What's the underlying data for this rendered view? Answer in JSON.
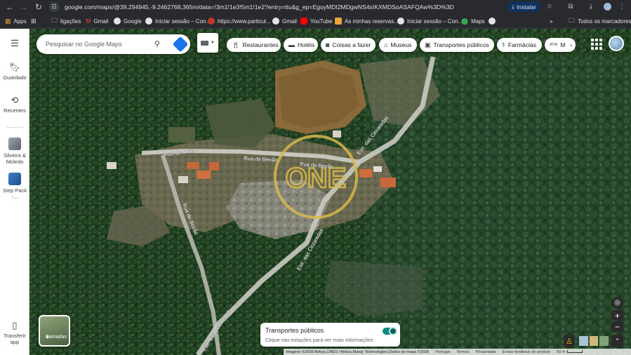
{
  "browser": {
    "url": "google.com/maps/@39.294945,-9.2462768,365m/data=!3m1!1e3!5m1!1e2?entry=ttu&g_ep=EgoyMDI2MDgwNS4xIKXMDSoASAFQAw%3D%3D",
    "install_label": "Instalar",
    "bookmarks": [
      {
        "label": "Apps",
        "icon": "apps-grid-icon"
      },
      {
        "label": "ligações",
        "icon": "folder-icon"
      },
      {
        "label": "Gmail",
        "icon": "gmail-icon"
      },
      {
        "label": "Google",
        "icon": "google-icon"
      },
      {
        "label": "Iniciar sessão – Con...",
        "icon": "google-icon"
      },
      {
        "label": "https://www.particul...",
        "icon": "site-icon"
      },
      {
        "label": "Gmail",
        "icon": "google-icon"
      },
      {
        "label": "YouTube",
        "icon": "youtube-icon"
      },
      {
        "label": "As minhas reservas...",
        "icon": "site-icon"
      },
      {
        "label": "Iniciar sessão – Con...",
        "icon": "google-icon"
      },
      {
        "label": "Maps",
        "icon": "maps-pin-icon"
      }
    ],
    "all_bookmarks_label": "Todos os marcadores"
  },
  "rail": {
    "saved_label": "Guardado",
    "recents_label": "Recentes",
    "recent_places": [
      {
        "label": "Silveira & Moledo"
      },
      {
        "label": "Step Pack -..."
      }
    ],
    "transfer_label": "Transferir app"
  },
  "search": {
    "placeholder": "Pesquisar no Google Maps"
  },
  "chips": [
    {
      "label": "Restaurantes",
      "icon": "fork-knife-icon"
    },
    {
      "label": "Hotéis",
      "icon": "bed-icon"
    },
    {
      "label": "Coisas a fazer",
      "icon": "camera-icon"
    },
    {
      "label": "Museus",
      "icon": "museum-icon"
    },
    {
      "label": "Transportes públicos",
      "icon": "train-icon"
    },
    {
      "label": "Farmácias",
      "icon": "pill-icon"
    },
    {
      "label": "M",
      "icon": "atm-icon",
      "icon_text": "ATM"
    }
  ],
  "map": {
    "roads": [
      {
        "label": "Rua do Beirão"
      },
      {
        "label": "Rua do Beirão"
      },
      {
        "label": "Rua do Beirão"
      },
      {
        "label": "Rua do Beirão"
      },
      {
        "label": "Estr. das Cezaredas"
      },
      {
        "label": "Estr. das Cezaredas"
      },
      {
        "label": "Estr. das Cezaredas"
      }
    ],
    "watermark_text": "ONE",
    "layers_label": "Camadas"
  },
  "transit_card": {
    "title": "Transportes públicos",
    "subtitle": "Clique nas estações para ver mais informações",
    "enabled": true
  },
  "footer": {
    "imagery": "Imagens ©2026 Airbus,CNES / Airbus,Maxar Technologies,Dados do mapa ©2026",
    "country": "Portugal",
    "terms": "Termos",
    "privacy": "Privacidade",
    "feedback": "Enviar feedback do produto",
    "scale": "50 m"
  }
}
